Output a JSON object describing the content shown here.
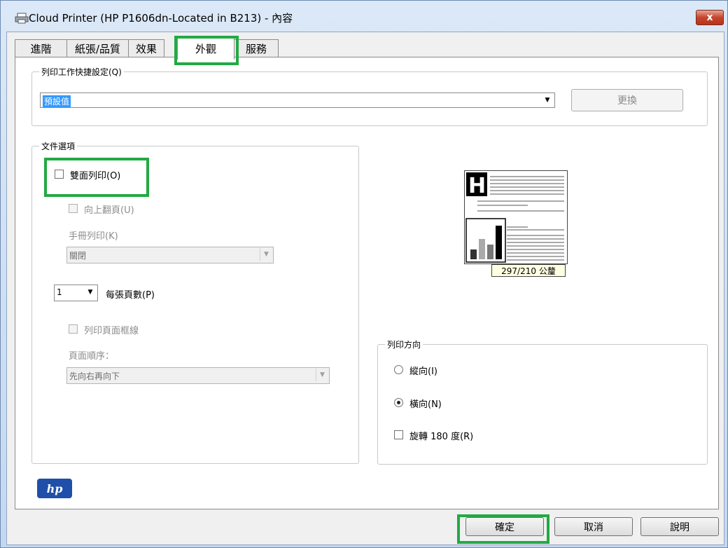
{
  "window": {
    "title": "Cloud Printer (HP P1606dn-Located in B213) - 內容",
    "close_label": "x"
  },
  "tabs": [
    {
      "label": "進階"
    },
    {
      "label": "紙張/品質"
    },
    {
      "label": "效果"
    },
    {
      "label": "外觀",
      "active": true
    },
    {
      "label": "服務"
    }
  ],
  "quick_sets": {
    "group_title": "列印工作快捷設定(Q)",
    "selected_value": "預設值",
    "change_button": "更換"
  },
  "document_options": {
    "group_title": "文件選項",
    "duplex_label": "雙面列印(O)",
    "duplex_checked": false,
    "flip_up_label": "向上翻頁(U)",
    "booklet_label": "手冊列印(K)",
    "booklet_value": "關閉",
    "pages_per_sheet_value": "1",
    "pages_per_sheet_label": "每張頁數(P)",
    "print_borders_label": "列印頁面框線",
    "page_order_label": "頁面順序：",
    "page_order_value": "先向右再向下"
  },
  "preview": {
    "size_label": "297/210 公釐"
  },
  "orientation": {
    "group_title": "列印方向",
    "portrait_label": "縱向(I)",
    "landscape_label": "橫向(N)",
    "selected": "landscape",
    "rotate_label": "旋轉 180 度(R)",
    "rotate_checked": false
  },
  "logo": {
    "text": "hp"
  },
  "buttons": {
    "ok": "確定",
    "cancel": "取消",
    "help": "說明"
  },
  "colors": {
    "highlight": "#22aa44",
    "selection": "#3399ff",
    "hp_blue": "#1f4fa8"
  }
}
